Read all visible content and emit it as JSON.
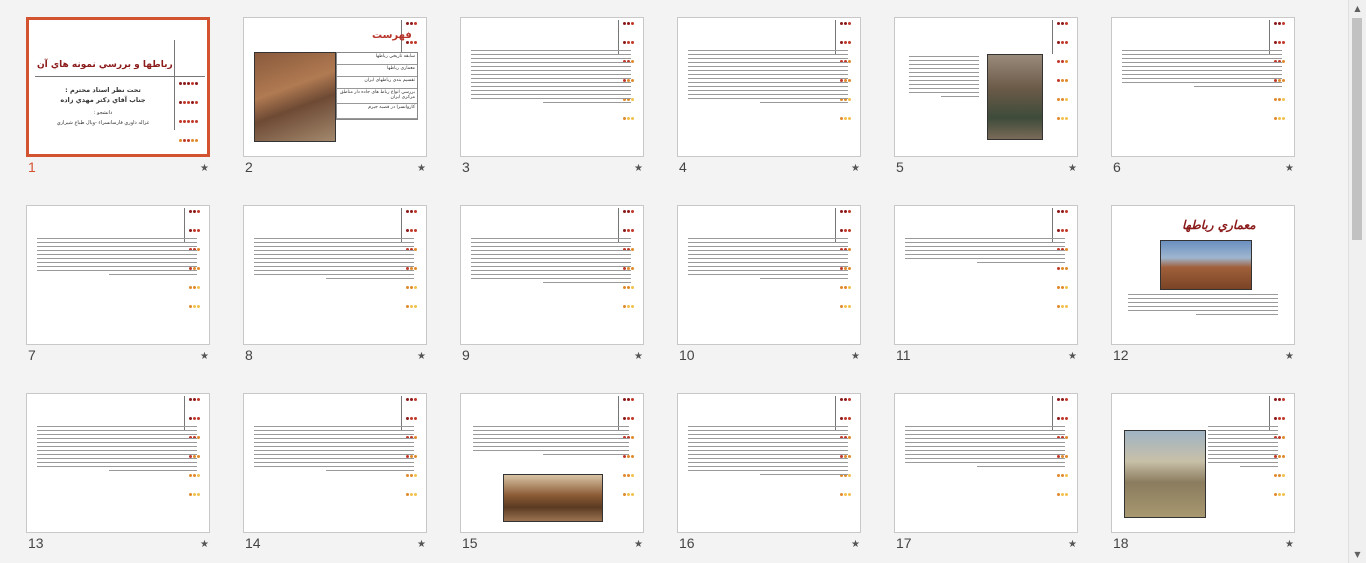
{
  "slide_sorter": {
    "slides": [
      {
        "number": "1",
        "selected": true,
        "kind": "title",
        "title": "رباطها و بررسي نمونه هاي آن",
        "subtitle_lines": [
          "تحت نظر استاد محترم :",
          "جناب آقاي دكتر مهدي زاده",
          "دانشجو :",
          "غزاله داوري فارسانسراء -ويال طباع شيرازي"
        ]
      },
      {
        "number": "2",
        "kind": "toc",
        "title": "فهرست",
        "toc_items": [
          "سابقه تاريخي رباطها",
          "معماري رباطها",
          "تقسيم بندي رباطهاي ايران",
          "بررسي انواع رباط هاي جاده دار مناطق مركزي ايران",
          "كاروانسرا در قصبه جيرم"
        ]
      },
      {
        "number": "3",
        "kind": "text",
        "lines": 14
      },
      {
        "number": "4",
        "kind": "text",
        "lines": 14
      },
      {
        "number": "5",
        "kind": "text-photo-right",
        "lines": 11
      },
      {
        "number": "6",
        "kind": "text",
        "lines": 10
      },
      {
        "number": "7",
        "kind": "text",
        "lines": 10
      },
      {
        "number": "8",
        "kind": "text",
        "lines": 11
      },
      {
        "number": "9",
        "kind": "text",
        "lines": 12
      },
      {
        "number": "10",
        "kind": "text",
        "lines": 11
      },
      {
        "number": "11",
        "kind": "text",
        "lines": 7
      },
      {
        "number": "12",
        "kind": "title-photo",
        "title": "معماري رباطها",
        "lines": 6
      },
      {
        "number": "13",
        "kind": "text",
        "lines": 12
      },
      {
        "number": "14",
        "kind": "text",
        "lines": 12
      },
      {
        "number": "15",
        "kind": "text-photo-bottom",
        "lines": 8
      },
      {
        "number": "16",
        "kind": "text",
        "lines": 13
      },
      {
        "number": "17",
        "kind": "text",
        "lines": 11
      },
      {
        "number": "18",
        "kind": "text-photo-left",
        "lines": 11
      }
    ],
    "star_glyph": "★"
  },
  "scrollbar": {
    "up_arrow": "▲",
    "down_arrow": "▼"
  },
  "colors": {
    "selection": "#d35230",
    "dots": [
      "#8b1a1a",
      "#c0392b",
      "#e08a2c",
      "#f2c14e"
    ]
  }
}
